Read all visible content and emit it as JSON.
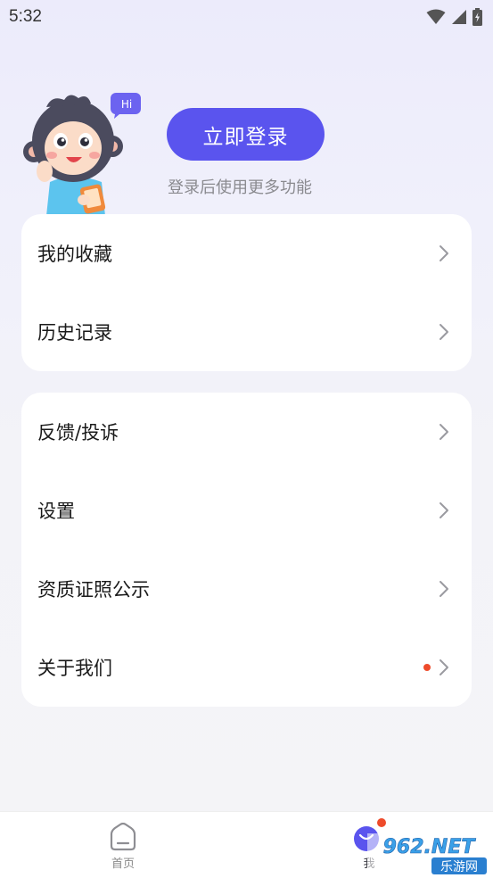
{
  "status_bar": {
    "time": "5:32"
  },
  "profile": {
    "greeting_bubble": "Hi",
    "login_button_label": "立即登录",
    "login_hint": "登录后使用更多功能"
  },
  "menu_group_1": [
    {
      "label": "我的收藏"
    },
    {
      "label": "历史记录"
    }
  ],
  "menu_group_2": [
    {
      "label": "反馈/投诉"
    },
    {
      "label": "设置"
    },
    {
      "label": "资质证照公示"
    },
    {
      "label": "关于我们",
      "has_dot": true
    }
  ],
  "tab_bar": {
    "home_label": "首页",
    "me_label": "我"
  },
  "watermark": {
    "text_top": "962.NET",
    "text_bottom": "乐游网"
  },
  "colors": {
    "accent": "#5a54ee",
    "dot": "#ee4b2b"
  }
}
